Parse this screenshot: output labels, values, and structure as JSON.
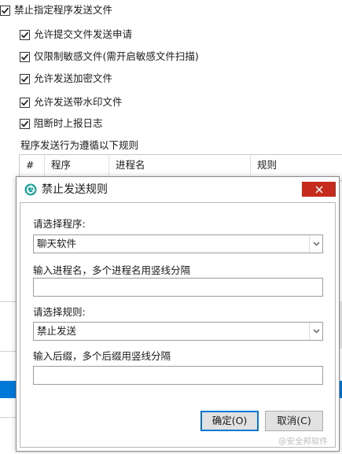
{
  "settings": {
    "block_send": {
      "label": "禁止指定程序发送文件",
      "checked": true
    },
    "options": [
      {
        "label": "允许提交文件发送申请",
        "checked": true
      },
      {
        "label": "仅限制敏感文件(需开启敏感文件扫描)",
        "checked": true
      },
      {
        "label": "允许发送加密文件",
        "checked": true
      },
      {
        "label": "允许发送带水印文件",
        "checked": true
      },
      {
        "label": "阻断时上报日志",
        "checked": true
      }
    ],
    "rules_caption": "程序发送行为遵循以下规则",
    "table_headers": [
      "#",
      "程序",
      "进程名",
      "规则"
    ]
  },
  "dialog": {
    "title": "禁止发送规则",
    "program_label": "请选择程序:",
    "program_value": "聊天软件",
    "process_label": "输入进程名，多个进程名用竖线分隔",
    "process_value": "",
    "rule_label": "请选择规则:",
    "rule_value": "禁止发送",
    "suffix_label": "输入后缀，多个后缀用竖线分隔",
    "suffix_value": "",
    "ok_label": "确定(O)",
    "cancel_label": "取消(C)"
  },
  "watermark": "@安全邦软件",
  "colors": {
    "close_button": "#c42b1c",
    "selection_blue": "#0078d7",
    "app_icon": "#1aa39a"
  },
  "icons": {
    "close": "close-icon",
    "checkbox": "checkmark-icon",
    "dropdown": "chevron-down-icon",
    "app": "app-logo-icon"
  }
}
